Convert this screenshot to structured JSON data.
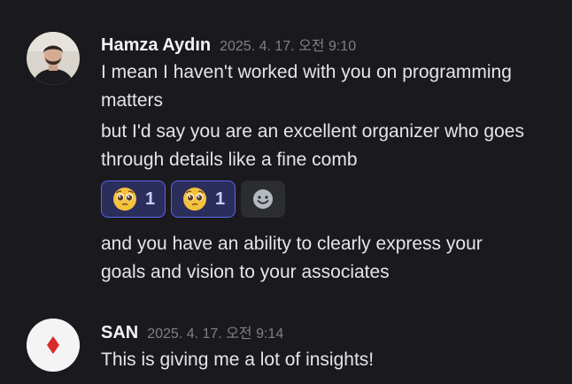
{
  "messages": [
    {
      "author": "Hamza Aydın",
      "timestamp": "2025. 4. 17. 오전 9:10",
      "avatar": "user-photo-avatar",
      "lines": [
        "I mean I haven't worked with you on programming",
        "matters",
        "but I'd say you are an excellent organizer who goes",
        "through details like a fine comb"
      ],
      "reactions": [
        {
          "emoji": "pleading-face-icon",
          "count": "1"
        },
        {
          "emoji": "pleading-face-icon",
          "count": "1"
        }
      ],
      "followup_lines": [
        "and you have an ability to clearly express your",
        "goals and vision to your associates"
      ]
    },
    {
      "author": "SAN",
      "timestamp": "2025. 4. 17. 오전 9:14",
      "avatar": "red-diamond-avatar",
      "lines": [
        "This is giving me a lot of insights!"
      ]
    }
  ],
  "colors": {
    "background": "#1a1a1e",
    "reaction_border": "#5865f2",
    "reaction_bg": "#2b2d5b",
    "diamond": "#d92b2b"
  }
}
